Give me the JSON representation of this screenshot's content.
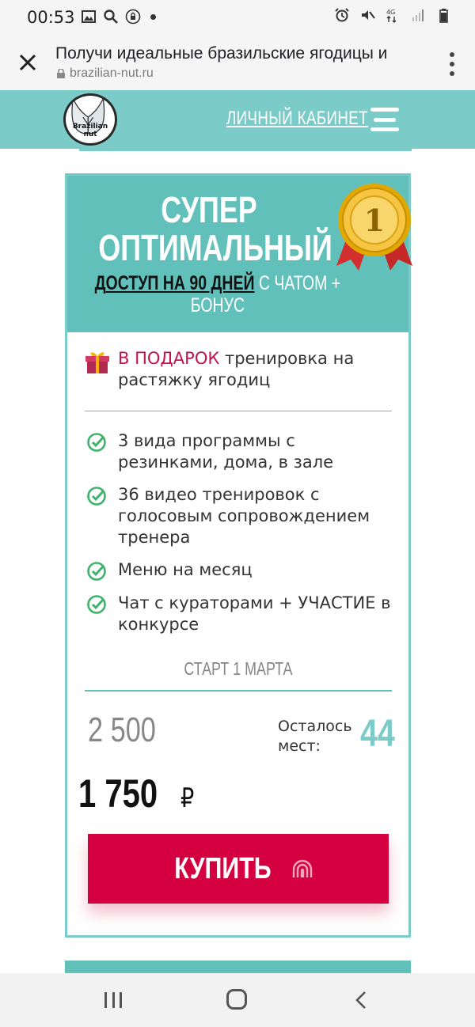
{
  "status_bar": {
    "time": "00:53"
  },
  "browser": {
    "title": "Получи идеальные бразильские ягодицы и",
    "url": "brazilian-nut.ru"
  },
  "header": {
    "logo_text": "Brazilian nut",
    "cabinet_link": "ЛИЧНЫЙ КАБИНЕТ"
  },
  "plan": {
    "title_line1": "СУПЕР",
    "title_line2": "ОПТИМАЛЬНЫЙ",
    "access_prefix": "Д",
    "access_underlined": "ОСТУП НА 90 ДНЕЙ",
    "access_suffix": " С ЧАТОМ + БОНУС",
    "medal_number": "1",
    "gift_accent": "В ПОДАРОК",
    "gift_text": " тренировка на растяжку ягодиц",
    "features": [
      "3 вида программы с резинками, дома, в зале",
      "36 видео тренировок с голосовым сопровождением тренера",
      "Меню на месяц",
      "Чат с кураторами + УЧАСТИЕ в конкурсе"
    ],
    "start": "СТАРТ 1 МАРТА",
    "old_price": "2 500",
    "seats_label": "Осталось мест:",
    "seats_left": "44",
    "new_price": "1 750",
    "currency": "₽",
    "buy_label": "КУПИТЬ"
  },
  "colors": {
    "teal": "#7bcbc9",
    "teal_dark": "#62c0bb",
    "buy_red": "#d4003f",
    "accent_red": "#c2134f"
  }
}
